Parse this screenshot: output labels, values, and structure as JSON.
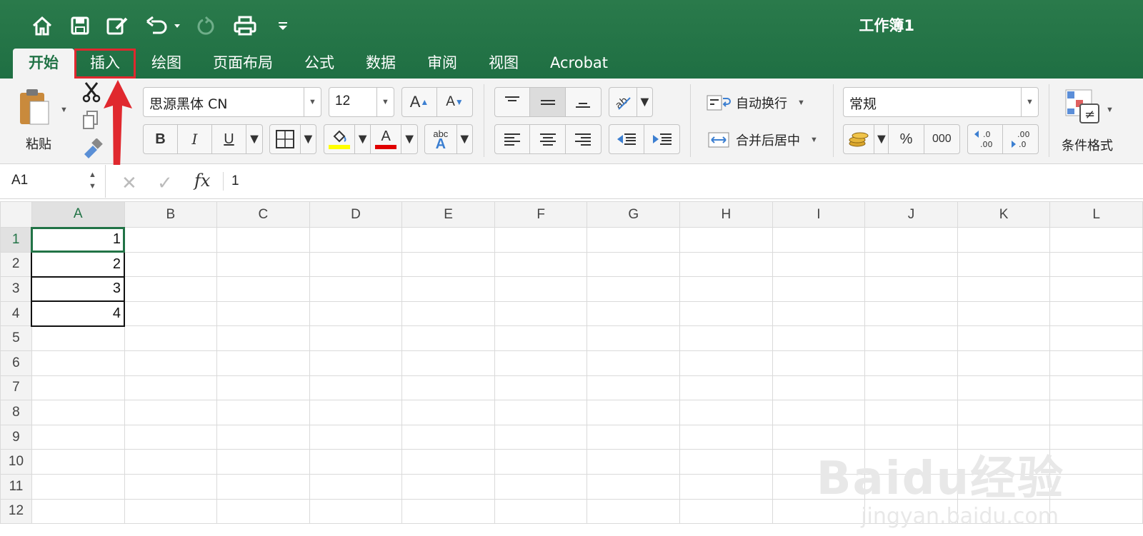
{
  "window": {
    "title": "工作簿1"
  },
  "tabs": [
    {
      "label": "开始",
      "active": true
    },
    {
      "label": "插入",
      "highlighted": true
    },
    {
      "label": "绘图"
    },
    {
      "label": "页面布局"
    },
    {
      "label": "公式"
    },
    {
      "label": "数据"
    },
    {
      "label": "审阅"
    },
    {
      "label": "视图"
    },
    {
      "label": "Acrobat"
    }
  ],
  "ribbon": {
    "paste_label": "粘贴",
    "font_name": "思源黑体 CN",
    "font_size": "12",
    "grow_font": "A",
    "shrink_font": "A",
    "bold": "B",
    "italic": "I",
    "underline": "U",
    "font_color_letter": "A",
    "abc_label": "abc",
    "abc_letter": "A",
    "wrap_text": "自动换行",
    "merge_center": "合并后居中",
    "number_format": "常规",
    "percent": "%",
    "thousands": "000",
    "inc_decimal": ".0\n.00",
    "dec_decimal": ".00\n.0",
    "conditional_format": "条件格式",
    "fill_color": "#ffff00",
    "font_color": "#e00000"
  },
  "formula_bar": {
    "name_box": "A1",
    "fx": "fx",
    "value": "1"
  },
  "sheet": {
    "columns": [
      "A",
      "B",
      "C",
      "D",
      "E",
      "F",
      "G",
      "H",
      "I",
      "J",
      "K",
      "L"
    ],
    "rows": [
      "1",
      "2",
      "3",
      "4",
      "5",
      "6",
      "7",
      "8",
      "9",
      "10",
      "11",
      "12"
    ],
    "cells": {
      "A1": "1",
      "A2": "2",
      "A3": "3",
      "A4": "4"
    },
    "selected_cell": "A1"
  },
  "watermark": {
    "line1": "Baidu经验",
    "line2": "jingyan.baidu.com"
  },
  "colors": {
    "brand_green": "#217346",
    "highlight_red": "#e0282e"
  }
}
